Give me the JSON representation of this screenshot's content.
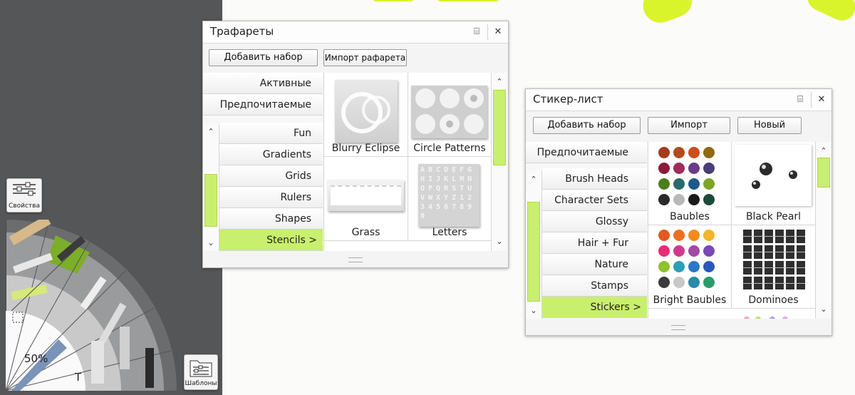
{
  "stencils_panel": {
    "title": "Трафареты",
    "add_set_label": "Добавить набор",
    "import_label": "Импорт рафарета",
    "top_categories": [
      "Активные",
      "Предпочитаемые"
    ],
    "categories": [
      "Fun",
      "Gradients",
      "Grids",
      "Rulers",
      "Shapes",
      "Stencils  >"
    ],
    "selected_category": "Stencils  >",
    "items": [
      "Blurry Eclipse",
      "Circle Patterns",
      "Grass",
      "Letters"
    ],
    "letters_glyphs": "ABCDEFGHIJKLMNOPQRSTUVWXYZ1234567890"
  },
  "sticker_panel": {
    "title": "Стикер-лист",
    "add_set_label": "Добавить набор",
    "import_label": "Импорт",
    "new_label": "Новый",
    "top_categories": [
      "Предпочитаемые"
    ],
    "categories": [
      "Brush Heads",
      "Character Sets",
      "Glossy",
      "Hair + Fur",
      "Nature",
      "Stamps",
      "Stickers  >"
    ],
    "selected_category": "Stickers  >",
    "items": [
      "Baubles",
      "Black Pearl",
      "Bright Baubles",
      "Dominoes"
    ]
  },
  "toolbar": {
    "properties_label": "Свойства",
    "templates_label": "Шаблоны",
    "zoom_label": "50%"
  },
  "colors": {
    "accent_green": "#c8ef6e",
    "canvas_stroke": "#d9f42a",
    "dark_gray": "#555657"
  },
  "icons": {
    "panel_menu": "⌸",
    "panel_close": "✕",
    "scroll_up": "⌃",
    "scroll_down": "⌄",
    "text_tool": "T"
  }
}
